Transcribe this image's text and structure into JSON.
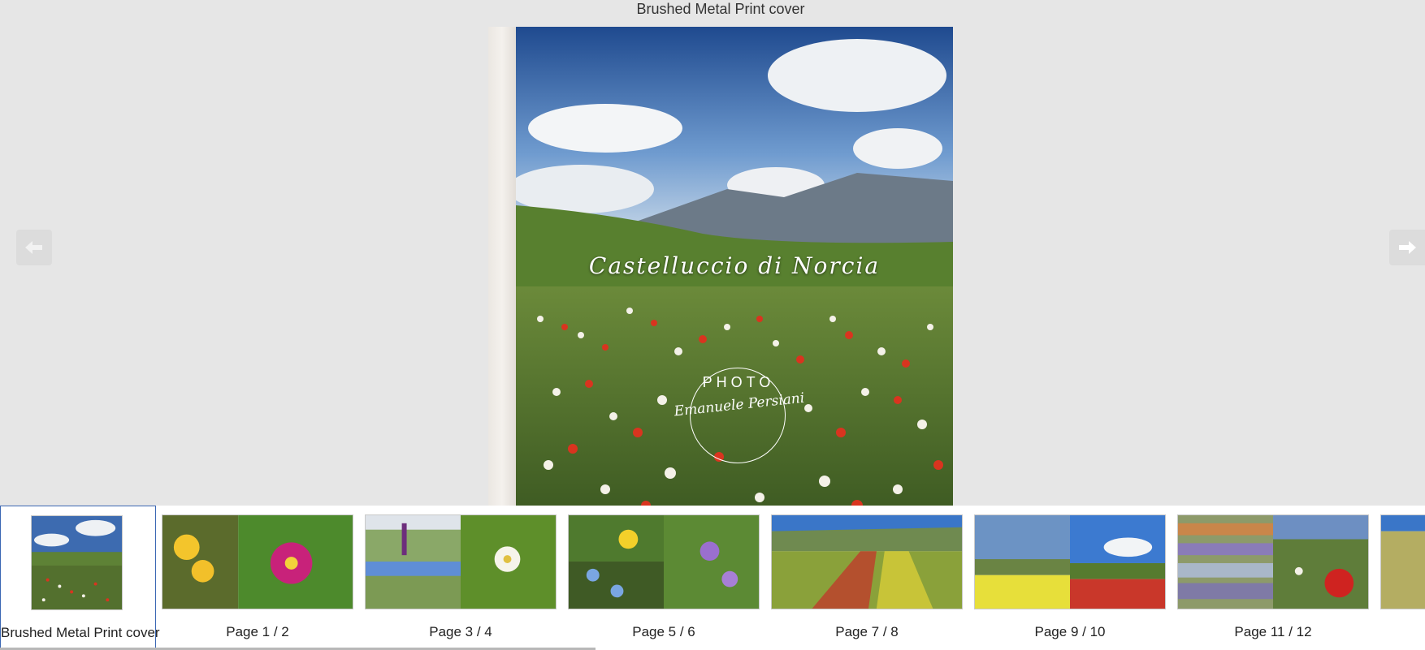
{
  "header": {
    "title": "Brushed Metal Print cover"
  },
  "nav": {
    "prev_icon": "arrow-left-icon",
    "next_icon": "arrow-right-icon"
  },
  "cover": {
    "title": "Castelluccio di Norcia",
    "logo_top": "PHOTO",
    "logo_signature": "Emanuele Persiani"
  },
  "thumbnails": [
    {
      "label": "Brushed Metal Print cover",
      "selected": true
    },
    {
      "label": "Page 1 / 2",
      "selected": false
    },
    {
      "label": "Page 3 / 4",
      "selected": false
    },
    {
      "label": "Page 5 / 6",
      "selected": false
    },
    {
      "label": "Page 7 / 8",
      "selected": false
    },
    {
      "label": "Page 9 / 10",
      "selected": false
    },
    {
      "label": "Page 11 / 12",
      "selected": false
    }
  ],
  "colors": {
    "selected_border": "#3b67b3",
    "background": "#e6e6e6"
  }
}
